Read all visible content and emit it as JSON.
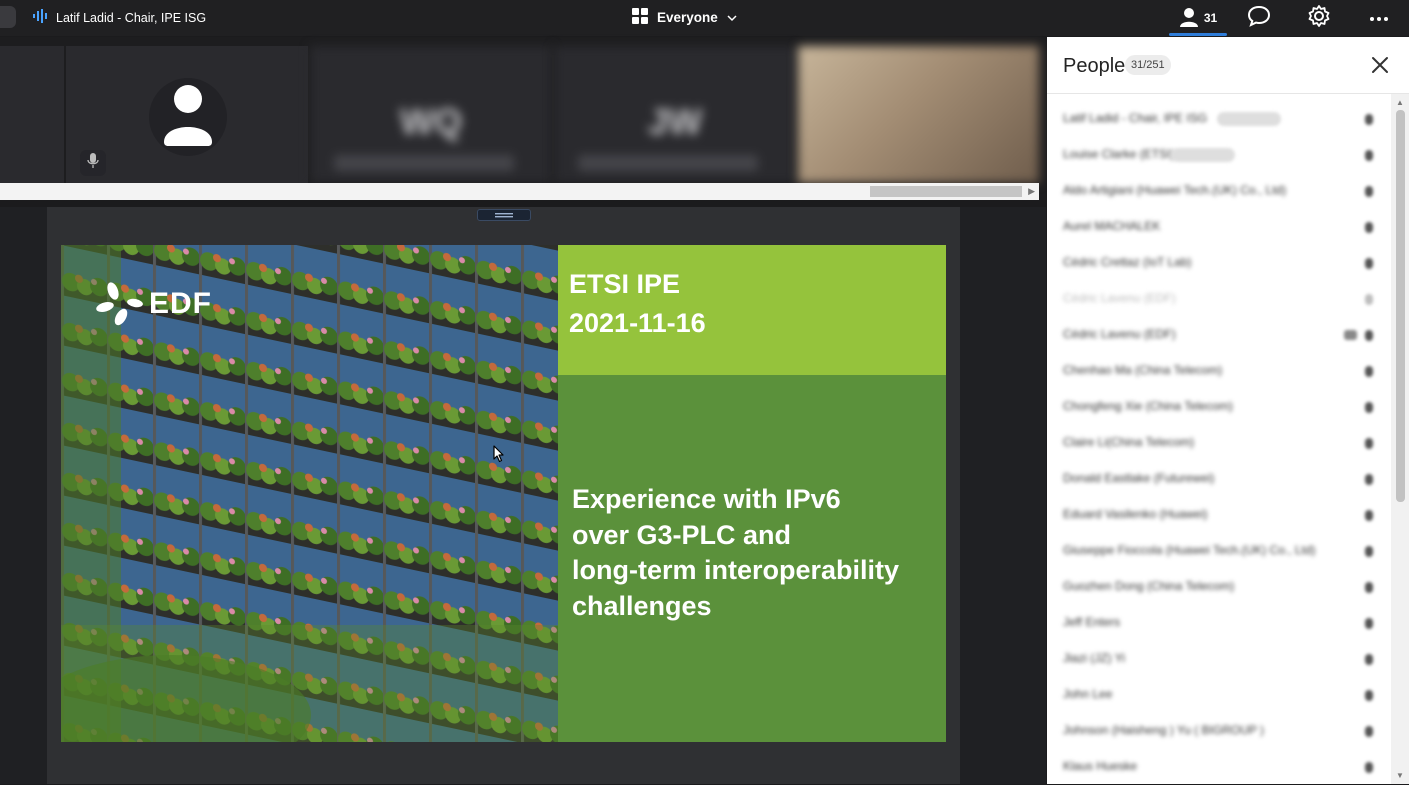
{
  "topbar": {
    "speaker_name": "Latif Ladid - Chair, IPE ISG",
    "view_label": "Everyone",
    "people_count": "31"
  },
  "strip": {
    "tiles": [
      {
        "initials": "WQ"
      },
      {
        "initials": "JW"
      }
    ]
  },
  "slide": {
    "logo_text": "EDF",
    "title": "ETSI IPE\n2021-11-16",
    "subtitle": "Experience with IPv6\nover G3-PLC and\nlong-term interoperability\nchallenges",
    "colors": {
      "title_box": "#95c33c",
      "body_box": "#5b913b"
    }
  },
  "panel": {
    "title": "People",
    "count": "31/251",
    "people": [
      {
        "name": "Latif Ladid - Chair, IPE ISG",
        "tag": "Organizer"
      },
      {
        "name": "Louise Clarke (ETSI)",
        "tag": "Organizer"
      },
      {
        "name": "Aldo Artigiani (Huawei Tech.(UK) Co., Ltd)"
      },
      {
        "name": "Aurel MACHALEK"
      },
      {
        "name": "Cédric Crettaz (IoT Lab)"
      },
      {
        "name": "Cédric Lavenu (EDF)",
        "faded": true
      },
      {
        "name": "Cédric Lavenu (EDF)",
        "chat": true
      },
      {
        "name": "Chenhao Ma (China Telecom)"
      },
      {
        "name": "Chongfeng Xie (China Telecom)"
      },
      {
        "name": "Claire Li(China Telecom)"
      },
      {
        "name": "Donald Eastlake (Futurewei)"
      },
      {
        "name": "Eduard Vasilenko (Huawei)"
      },
      {
        "name": "Giuseppe Fioccola (Huawei Tech.(UK) Co., Ltd)"
      },
      {
        "name": "Guozhen Dong (China Telecom)"
      },
      {
        "name": "Jeff Enters"
      },
      {
        "name": "Jiazi (JZ) Yi"
      },
      {
        "name": "John Lee"
      },
      {
        "name": "Johnson (Haisheng ) Yu ( BIGROUP )"
      },
      {
        "name": "Klaus Hueske"
      }
    ]
  }
}
